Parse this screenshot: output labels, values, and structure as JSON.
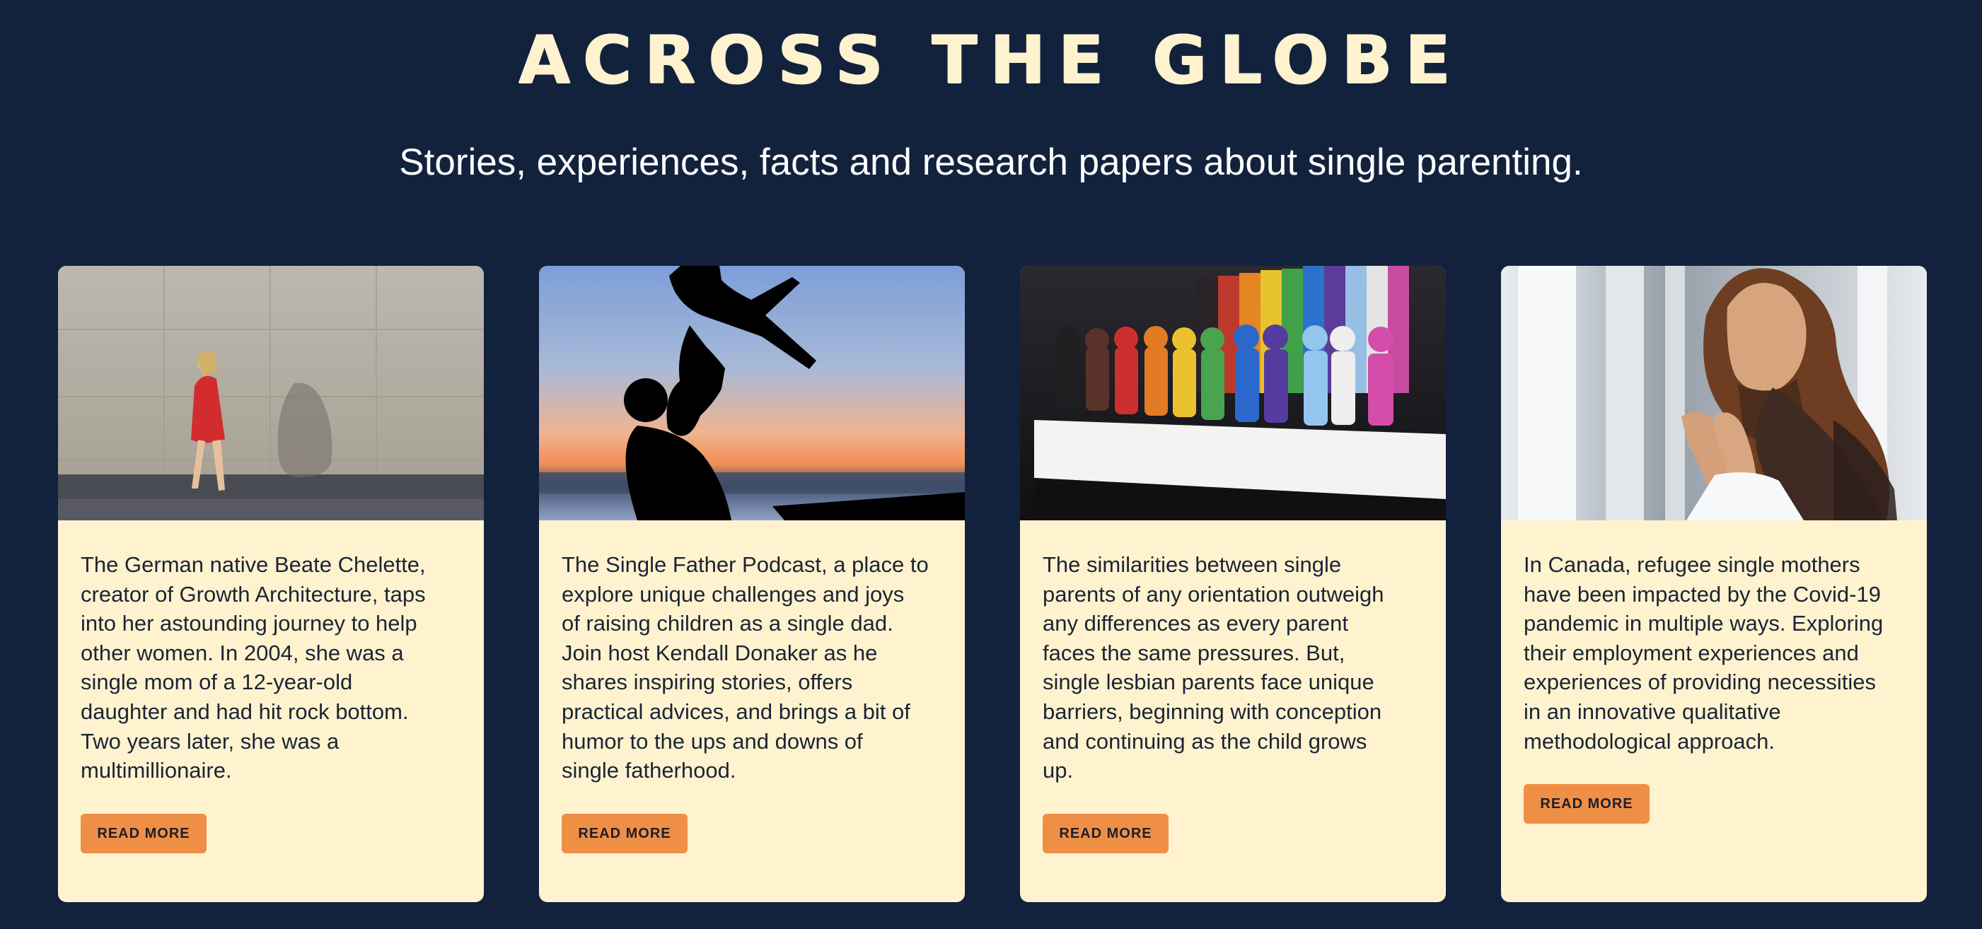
{
  "header": {
    "title": "ACROSS THE GLOBE",
    "subtitle": "Stories, experiences, facts and research papers about single parenting."
  },
  "colors": {
    "page_background": "#12223d",
    "card_background": "#fff3cf",
    "title_color": "#fff3cf",
    "button_color": "#ef8f46"
  },
  "cards": [
    {
      "image_label": "woman in red coat walking by concrete wall",
      "text": "The German native Beate Chelette,\ncreator of Growth Architecture, taps\ninto her astounding journey to help\nother women. In 2004, she was a\nsingle mom  of a 12-year-old\ndaughter and had hit rock bottom.\nTwo years later, she was a\nmultimillionaire.",
      "button_label": "READ MORE"
    },
    {
      "image_label": "father silhouette lifting child at sunset",
      "text": "The Single Father Podcast, a place to\nexplore unique challenges and joys\nof raising children as a single dad.\nJoin host Kendall Donaker as he\nshares inspiring stories, offers\npractical advices, and brings a bit of\nhumor to the ups and downs of\nsingle fatherhood.",
      "button_label": "READ MORE"
    },
    {
      "image_label": "rainbow lego figures on stand",
      "text": "The similarities between single\nparents of any orientation outweigh\nany differences as every parent\nfaces the same pressures. But,\nsingle lesbian parents face unique\nbarriers, beginning with conception\nand continuing as the child grows\nup.",
      "button_label": "READ MORE"
    },
    {
      "image_label": "woman in hijab with hands together",
      "text": "In Canada, refugee single mothers\nhave been impacted by the Covid-19\npandemic in multiple ways. Exploring\ntheir employment experiences and\nexperiences of providing necessities\nin an innovative qualitative\nmethodological approach.",
      "button_label": "READ MORE"
    }
  ]
}
